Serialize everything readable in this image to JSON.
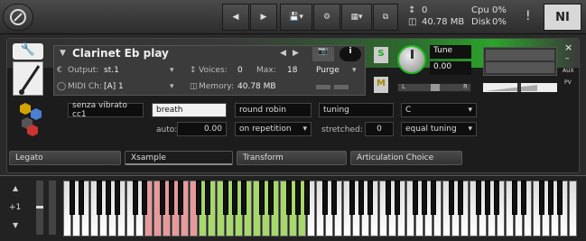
{
  "toolbar": {
    "cpu_label": "Cpu",
    "cpu_value": "0%",
    "disk_label": "Disk",
    "disk_value": "0%",
    "voices_value": "0",
    "memory_value": "40.78 MB",
    "warn": "!",
    "ni": "NI"
  },
  "instrument": {
    "name": "Clarinet Eb play",
    "output_label": "Output:",
    "output_value": "st.1",
    "midi_label": "MIDI Ch:",
    "midi_value": "[A]  1",
    "voices_label": "Voices:",
    "voices_value": "0",
    "max_label": "Max:",
    "max_value": "18",
    "memory_label": "Memory:",
    "memory_value": "40.78 MB",
    "purge_label": "Purge",
    "solo": "S",
    "mute": "M",
    "tune_label": "Tune",
    "tune_value": "0.00",
    "pan_l": "L",
    "pan_r": "R",
    "aux": "AUX",
    "pv": "PV",
    "close": "×",
    "minus": "–"
  },
  "controls": {
    "senza": "senza vibrato cc1",
    "breath": "breath",
    "round_robin": "round robin",
    "tuning": "tuning",
    "key_select": "C",
    "auto_label": "auto:",
    "auto_value": "0.00",
    "on_repetition": "on repetition",
    "stretched_label": "stretched:",
    "stretched_value": "0",
    "equal_tuning": "equal tuning"
  },
  "tabs": [
    "Legato",
    "Xsample",
    "Transform",
    "Articulation Choice"
  ],
  "keyboard": {
    "octave": "+1"
  },
  "colors": {
    "accent_green": "#3fbf3f",
    "key_red": "#e89a9a",
    "key_green": "#a6d86a"
  }
}
